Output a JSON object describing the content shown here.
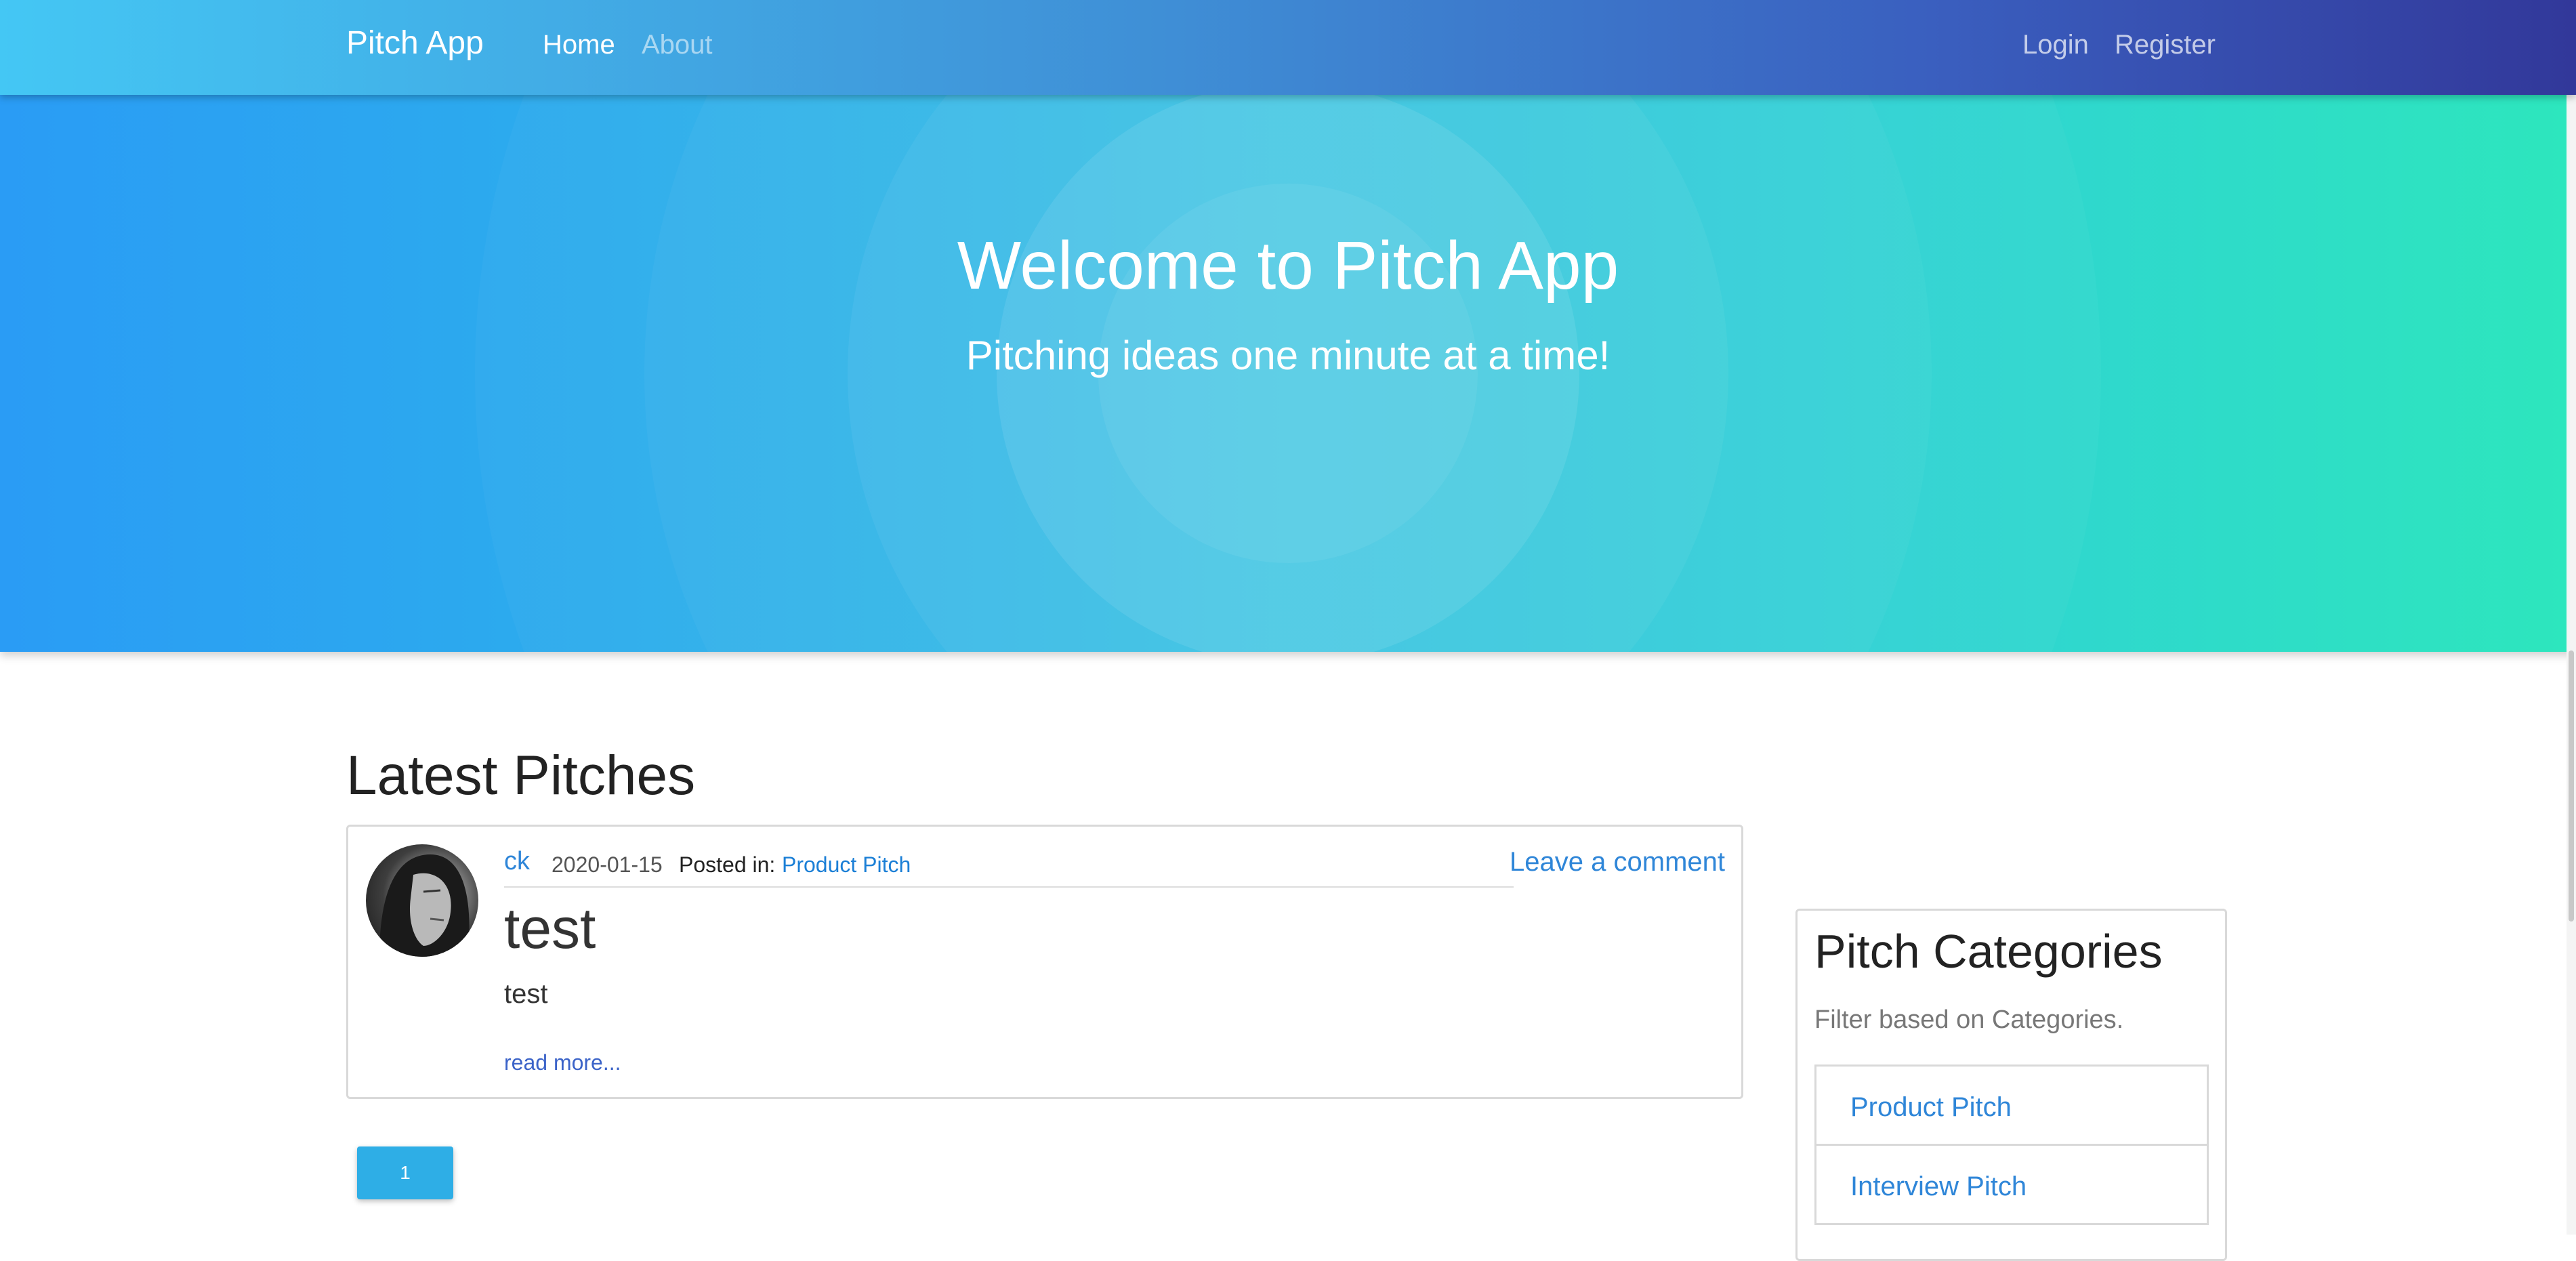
{
  "navbar": {
    "brand": "Pitch App",
    "links": [
      {
        "label": "Home"
      },
      {
        "label": "About"
      }
    ],
    "auth": [
      {
        "label": "Login"
      },
      {
        "label": "Register"
      }
    ]
  },
  "hero": {
    "title": "Welcome to Pitch App",
    "subtitle": "Pitching ideas one minute at a time!"
  },
  "latest": {
    "title": "Latest Pitches",
    "pitches": [
      {
        "author": "ck",
        "date": "2020-01-15",
        "posted_label": "Posted in:",
        "category": "Product Pitch",
        "comment_label": "Leave a comment",
        "title": "test",
        "body": "test",
        "read_more": "read more..."
      }
    ],
    "pagination": {
      "current": "1"
    }
  },
  "categories": {
    "title": "Pitch Categories",
    "subtitle": "Filter based on Categories.",
    "items": [
      {
        "label": "Product Pitch"
      },
      {
        "label": "Interview Pitch"
      }
    ]
  },
  "colors": {
    "link": "#2f86d8",
    "accent": "#2eaee6"
  }
}
